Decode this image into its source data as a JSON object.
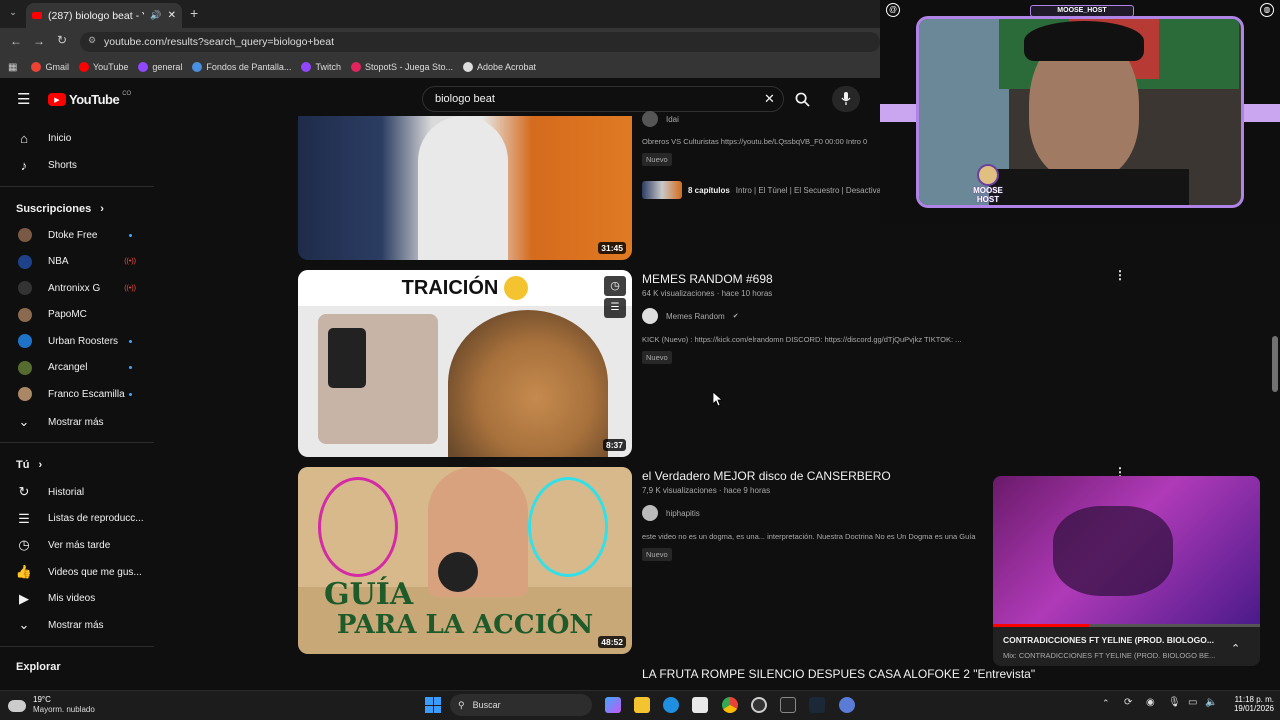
{
  "browser": {
    "tab_title": "(287) biologo beat - YouTube",
    "url": "youtube.com/results?search_query=biologo+beat",
    "bookmarks": [
      {
        "label": "Gmail",
        "color": "#ea4335"
      },
      {
        "label": "YouTube",
        "color": "#ff0000"
      },
      {
        "label": "general",
        "color": "#9147ff"
      },
      {
        "label": "Fondos de Pantalla...",
        "color": "#4a90e2"
      },
      {
        "label": "Twitch",
        "color": "#9146ff"
      },
      {
        "label": "StopotS - Juega Sto...",
        "color": "#e0245e"
      },
      {
        "label": "Adobe Acrobat",
        "color": "#dddddd"
      }
    ]
  },
  "youtube": {
    "logo_text": "YouTube",
    "logo_sup": "CO",
    "search_value": "biologo beat"
  },
  "sidebar": {
    "top": [
      {
        "label": "Inicio",
        "icon": "home-icon",
        "glyph": "⌂"
      },
      {
        "label": "Shorts",
        "icon": "shorts-icon",
        "glyph": "♪"
      }
    ],
    "subs_header": "Suscripciones",
    "subs": [
      {
        "label": "Dtoke Free",
        "color": "#7a5a44",
        "badge": "dot"
      },
      {
        "label": "NBA",
        "color": "#1d428a",
        "badge": "live"
      },
      {
        "label": "Antronixx G",
        "color": "#333333",
        "badge": "live"
      },
      {
        "label": "PapoMC",
        "color": "#8c6a4f",
        "badge": ""
      },
      {
        "label": "Urban Roosters",
        "color": "#1e73c8",
        "badge": "dot"
      },
      {
        "label": "Arcangel",
        "color": "#556b2f",
        "badge": "dot"
      },
      {
        "label": "Franco Escamilla",
        "color": "#aa8866",
        "badge": "dot"
      }
    ],
    "subs_more": "Mostrar más",
    "you_header": "Tú",
    "you": [
      {
        "label": "Historial",
        "icon": "history-icon",
        "glyph": "↻"
      },
      {
        "label": "Listas de reproducc...",
        "icon": "playlist-icon",
        "glyph": "☰"
      },
      {
        "label": "Ver más tarde",
        "icon": "clock-icon",
        "glyph": "◷"
      },
      {
        "label": "Videos que me gus...",
        "icon": "thumb-up-icon",
        "glyph": "👍"
      },
      {
        "label": "Mis videos",
        "icon": "my-videos-icon",
        "glyph": "▶"
      }
    ],
    "you_more": "Mostrar más",
    "explore_header": "Explorar"
  },
  "results": [
    {
      "duration": "31:45",
      "channel": "Idai",
      "desc": "Obreros VS Culturistas https://youtu.be/LQssbqVB_F0 00:00 Intro 0",
      "badge": "Nuevo",
      "chapters_label": "8 capítulos",
      "chapters_text": "Intro | El Túnel | El Secuestro | Desactivac"
    },
    {
      "title": "MEMES RANDOM #698",
      "meta": "64 K visualizaciones · hace 10 horas",
      "channel": "Memes Random",
      "desc": "KICK (Nuevo) : https://kick.com/elrandomn DISCORD: https://discord.gg/dTjQuPvjkz TIKTOK: ...",
      "badge": "Nuevo",
      "duration": "8:37",
      "thumb_text": "TRAICIÓN"
    },
    {
      "title": "el Verdadero MEJOR disco de CANSERBERO",
      "meta": "7,9 K visualizaciones · hace 9 horas",
      "channel": "hiphapitis",
      "desc": "este video no es un dogma, es una... interpretación. Nuestra Doctrina No es Un Dogma es una Guía",
      "badge": "Nuevo",
      "duration": "48:52",
      "thumb_text_1": "GUÍA",
      "thumb_text_2": "PARA LA ACCIÓN"
    },
    {
      "title": "LA FRUTA ROMPE SILENCIO DESPUES CASA ALOFOKE 2 \"Entrevista\""
    }
  ],
  "webcam": {
    "name": "MOOSE_HOST",
    "logo_text": "MOOSE HOST"
  },
  "miniplayer": {
    "title": "CONTRADICCIONES FT YELINE (PROD. BIOLOGO...",
    "subtitle": "Mix: CONTRADICCIONES FT YELINE (PROD. BIOLOGO BE...",
    "progress": 0.36
  },
  "taskbar": {
    "weather_temp": "19°C",
    "weather_desc": "Mayorm. nublado",
    "search_placeholder": "Buscar",
    "time": "11:18 p. m.",
    "date": "19/01/2026"
  }
}
